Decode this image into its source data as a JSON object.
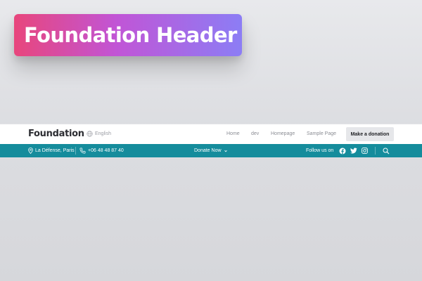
{
  "hero": {
    "title": "Foundation Header"
  },
  "header": {
    "logo": "Foundation",
    "language": "English",
    "nav": [
      "Home",
      "dev",
      "Homepage",
      "Sample Page"
    ],
    "cta_label": "Make a donation"
  },
  "info_bar": {
    "location": "La Défense, Paris",
    "phone": "+06 48 48 87 40",
    "donate_label": "Donate Now",
    "follow_label": "Follow us on",
    "social_icons": [
      "facebook-icon",
      "twitter-icon",
      "instagram-icon"
    ],
    "background": "#158c9c"
  },
  "colors": {
    "hero_gradient_start": "#e8467c",
    "hero_gradient_end": "#8c7df5",
    "logo_text": "#2d2e33",
    "cta_bg": "#e6e7ea"
  }
}
